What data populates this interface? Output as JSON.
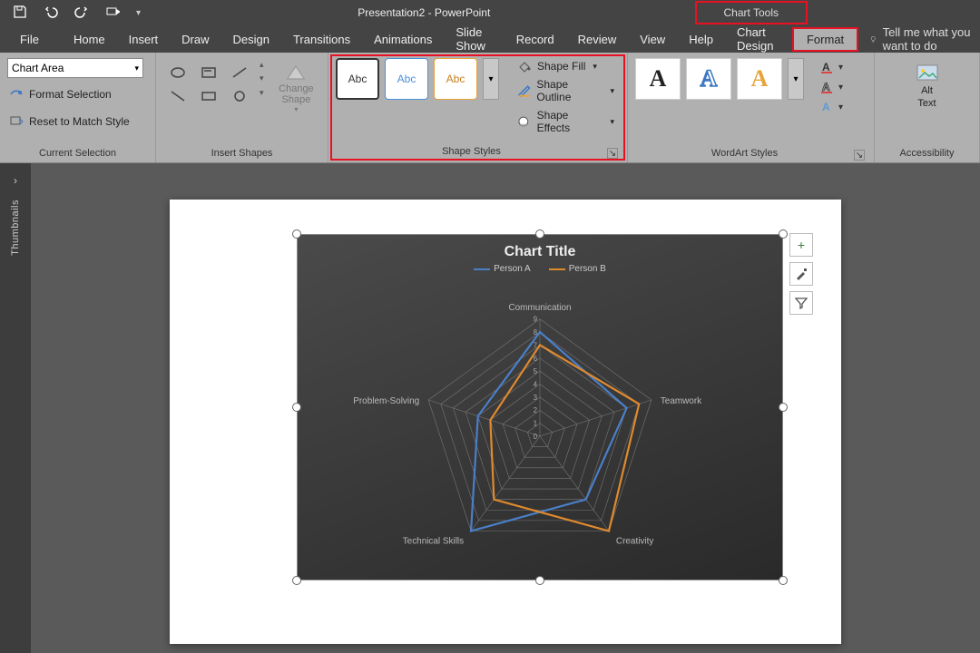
{
  "titlebar": {
    "title": "Presentation2  -  PowerPoint",
    "context_tab": "Chart Tools"
  },
  "tabs": [
    "File",
    "Home",
    "Insert",
    "Draw",
    "Design",
    "Transitions",
    "Animations",
    "Slide Show",
    "Record",
    "Review",
    "View",
    "Help",
    "Chart Design",
    "Format"
  ],
  "active_tab": "Format",
  "tellme": "Tell me what you want to do",
  "ribbon": {
    "current_selection": {
      "dropdown": "Chart Area",
      "format_selection": "Format Selection",
      "reset": "Reset to Match Style",
      "label": "Current Selection"
    },
    "insert_shapes": {
      "change_shape": "Change Shape",
      "label": "Insert Shapes"
    },
    "shape_styles": {
      "abc": "Abc",
      "fill": "Shape Fill",
      "outline": "Shape Outline",
      "effects": "Shape Effects",
      "label": "Shape Styles"
    },
    "wordart": {
      "label": "WordArt Styles"
    },
    "accessibility": {
      "alt_text_1": "Alt",
      "alt_text_2": "Text",
      "label": "Accessibility"
    }
  },
  "thumbnails_label": "Thumbnails",
  "chart_side": {
    "plus": "+",
    "brush": "✎",
    "filter": "▼"
  },
  "chart_data": {
    "type": "radar",
    "title": "Chart Title",
    "categories": [
      "Communication",
      "Teamwork",
      "Creativity",
      "Technical Skills",
      "Problem-Solving"
    ],
    "ticks": [
      0,
      1,
      2,
      3,
      4,
      5,
      6,
      7,
      8,
      9
    ],
    "max": 9,
    "series": [
      {
        "name": "Person A",
        "color": "#4a7fc9",
        "values": [
          8,
          7,
          6,
          9,
          5
        ]
      },
      {
        "name": "Person B",
        "color": "#e08a2e",
        "values": [
          7,
          8,
          9,
          6,
          4
        ]
      }
    ]
  }
}
